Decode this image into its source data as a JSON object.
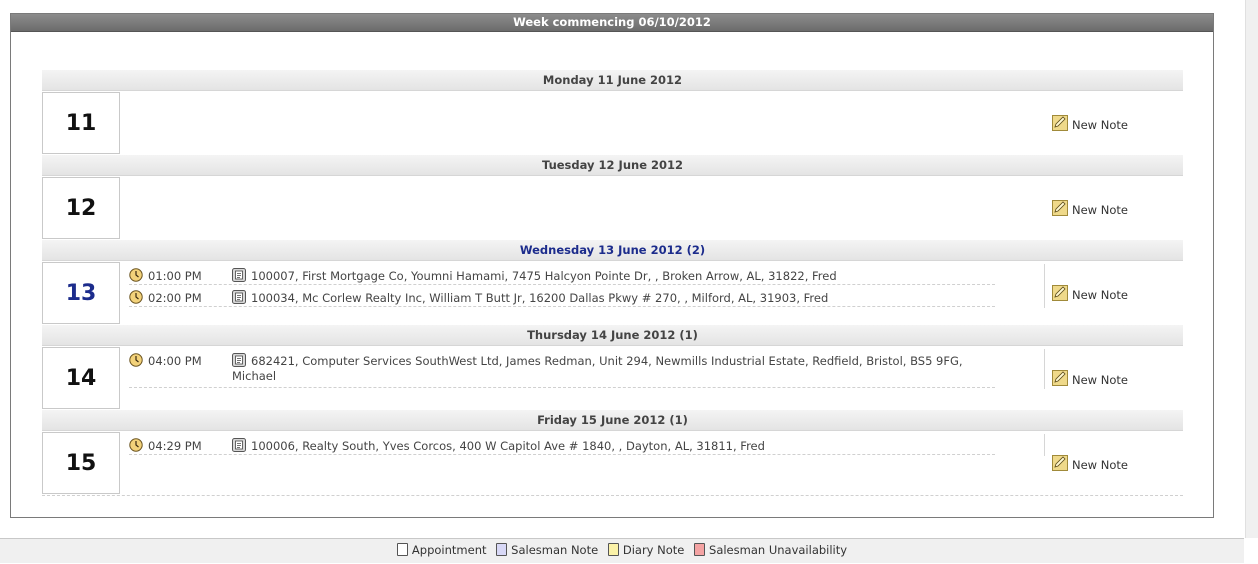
{
  "header": {
    "title": "Week commencing 06/10/2012"
  },
  "new_note_label": "New Note",
  "days": [
    {
      "header": "Monday 11 June 2012",
      "number": "11",
      "active": false,
      "entries": []
    },
    {
      "header": "Tuesday 12 June 2012",
      "number": "12",
      "active": false,
      "entries": []
    },
    {
      "header": "Wednesday 13 June 2012 (2)",
      "number": "13",
      "active": true,
      "entries": [
        {
          "time": "01:00 PM",
          "text": "100007, First Mortgage Co, Youmni Hamami, 7475 Halcyon Pointe Dr, , Broken Arrow, AL, 31822, Fred"
        },
        {
          "time": "02:00 PM",
          "text": "100034, Mc Corlew Realty Inc, William T Butt Jr, 16200 Dallas Pkwy # 270, , Milford, AL, 31903, Fred"
        }
      ]
    },
    {
      "header": "Thursday 14 June 2012 (1)",
      "number": "14",
      "active": false,
      "entries": [
        {
          "time": "04:00 PM",
          "text": "682421, Computer Services SouthWest Ltd, James Redman, Unit 294, Newmills Industrial Estate, Redfield, Bristol, BS5 9FG, Michael"
        }
      ]
    },
    {
      "header": "Friday 15 June 2012 (1)",
      "number": "15",
      "active": false,
      "entries": [
        {
          "time": "04:29 PM",
          "text": "100006, Realty South, Yves Corcos, 400 W Capitol Ave # 1840, , Dayton, AL, 31811, Fred"
        }
      ]
    }
  ],
  "legend": [
    {
      "label": "Appointment",
      "color": "#ffffff"
    },
    {
      "label": "Salesman Note",
      "color": "#d8d8f6"
    },
    {
      "label": "Diary Note",
      "color": "#fbf2a8"
    },
    {
      "label": "Salesman Unavailability",
      "color": "#f4a3a3"
    }
  ]
}
